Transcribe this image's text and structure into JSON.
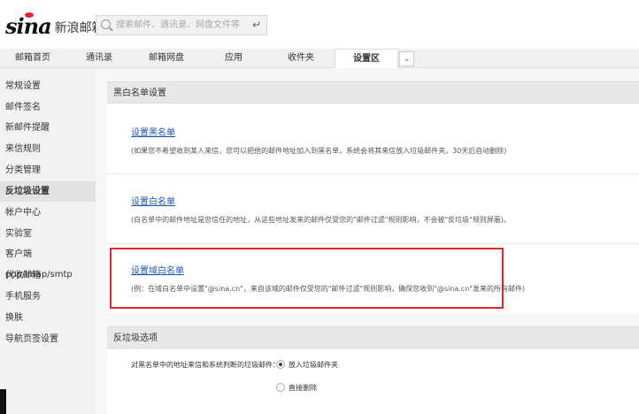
{
  "logo": {
    "brand": "sina",
    "product": "新浪邮箱"
  },
  "search": {
    "placeholder": "搜索邮件、通讯录、网盘文件等",
    "enter_symbol": "↵"
  },
  "tabs": [
    {
      "label": "邮箱首页"
    },
    {
      "label": "通讯录"
    },
    {
      "label": "邮箱网盘"
    },
    {
      "label": "应用"
    },
    {
      "label": "收件夹"
    },
    {
      "label": "设置区"
    }
  ],
  "tab_more_symbol": "⌄",
  "sidebar": {
    "items": [
      {
        "label": "常规设置"
      },
      {
        "label": "邮件签名"
      },
      {
        "label": "新邮件提醒"
      },
      {
        "label": "来信规则"
      },
      {
        "label": "分类管理"
      },
      {
        "label": "反垃圾设置"
      },
      {
        "label": "帐户中心"
      },
      {
        "label": "实验室"
      },
      {
        "label": "客户端pop/imap/smtp"
      },
      {
        "label": "代收邮箱"
      },
      {
        "label": "手机服务"
      },
      {
        "label": "换肤"
      },
      {
        "label": "导航页签设置"
      }
    ]
  },
  "section1": {
    "title": "黑白名单设置",
    "blocks": [
      {
        "link": "设置黑名单",
        "desc": "(如果您不希望收到某人来信，您可以把他的邮件地址加入到黑名单，系统会将其来信放入垃圾邮件夹，30天后自动删除)"
      },
      {
        "link": "设置白名单",
        "desc": "(白名单中的邮件地址是您信任的地址，从这些地址发来的邮件仅受您的\"邮件过滤\"规则影响，不会被\"反垃圾\"规则屏蔽)。"
      },
      {
        "link": "设置域白名单",
        "desc": "(例：在域白名单中设置\"@sina.cn\"，来自该域的邮件仅受您的\"邮件过滤\"规则影响，确保您收到\"@sina.cn\"发来的所有邮件)"
      }
    ]
  },
  "section2": {
    "title": "反垃圾选项",
    "option_label": "对黑名单中的地址来信和系统判断的垃圾邮件：",
    "options": [
      {
        "label": "放入垃圾邮件夹",
        "selected": true
      },
      {
        "label": "直接删除",
        "selected": false
      }
    ]
  },
  "colors": {
    "link": "#1a56b0",
    "highlight": "#e0282c",
    "logo_eye": "#e22233"
  }
}
